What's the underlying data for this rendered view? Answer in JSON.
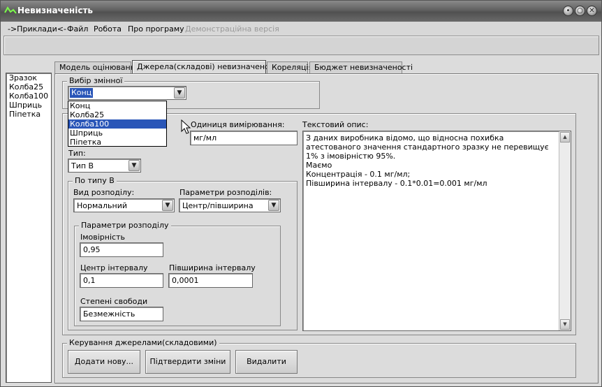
{
  "window": {
    "title": "Невизначеність"
  },
  "menu": [
    "->Приклади<-",
    "Файл",
    "Робота",
    "Про програму"
  ],
  "menu_disabled": "Демонстраційна версія",
  "left_list": [
    "Зразок",
    "Колба25",
    "Колба100",
    "Шприць",
    "Піпетка"
  ],
  "tabs": [
    "Модель оцінювання",
    "Джерела(складові) невизначеності",
    "Кореляція",
    "Бюджет невизначеності"
  ],
  "active_tab": "Джерела(складові) невизначеності",
  "variable_select": {
    "legend": "Вибір змінної",
    "value": "Конц",
    "options": [
      "Конц",
      "Колба25",
      "Колба100",
      "Шприць",
      "Піпетка"
    ],
    "highlighted": "Колба100"
  },
  "unit": {
    "label": "Одиниця вимірювання:",
    "value": "мг/мл"
  },
  "text_description": {
    "label": "Текстовий опис:",
    "lines": [
      "З даних виробника відомо, що відносна похибка атестованого значення стандартного зразку не перевищує 1% з імовірністю 95%.",
      "Маємо",
      "Концентрація - 0.1 мг/мл;",
      "Півширина інтервалу - 0.1*0.01=0.001 мг/мл"
    ]
  },
  "type": {
    "label": "Тип:",
    "value": "Тип В"
  },
  "type_b": {
    "legend": "По типу В",
    "distribution_label": "Вид розподілу:",
    "distribution_value": "Нормальний",
    "params_label": "Параметри розподілів:",
    "params_value": "Центр/півширина"
  },
  "dist_params": {
    "legend": "Параметри розподілу",
    "probability_label": "Імовірність",
    "probability_value": "0,95",
    "center_label": "Центр інтервалу",
    "center_value": "0,1",
    "halfwidth_label": "Півширина інтервалу",
    "halfwidth_value": "0,0001",
    "dof_label": "Степені свободи",
    "dof_value": "Безмежність"
  },
  "controls": {
    "legend": "Керування джерелами(складовими)",
    "add": "Додати нову...",
    "confirm": "Підтвердити зміни",
    "delete": "Видалити"
  },
  "colors": {
    "selection": "#2a56b8",
    "titlebar": "#606060"
  }
}
